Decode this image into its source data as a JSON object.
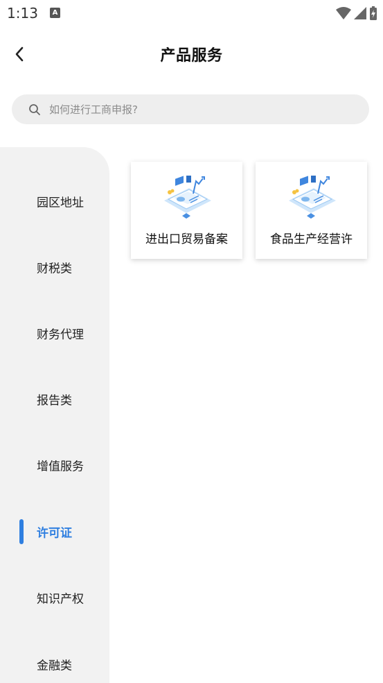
{
  "status_bar": {
    "time": "1:13",
    "notification_icon": "A"
  },
  "header": {
    "title": "产品服务"
  },
  "search": {
    "placeholder": "如何进行工商申报?"
  },
  "sidebar": {
    "items": [
      {
        "label": "园区地址"
      },
      {
        "label": "财税类"
      },
      {
        "label": "财务代理"
      },
      {
        "label": "报告类"
      },
      {
        "label": "增值服务"
      },
      {
        "label": "许可证"
      },
      {
        "label": "知识产权"
      },
      {
        "label": "金融类"
      }
    ],
    "active_index": 5
  },
  "products": [
    {
      "title": "进出口贸易备案",
      "icon": "business-document-illustration"
    },
    {
      "title": "食品生产经营许",
      "icon": "business-document-illustration"
    }
  ],
  "colors": {
    "accent": "#2f7fe0",
    "sidebar_bg": "#f2f2f2",
    "search_bg": "#eeeeee"
  }
}
